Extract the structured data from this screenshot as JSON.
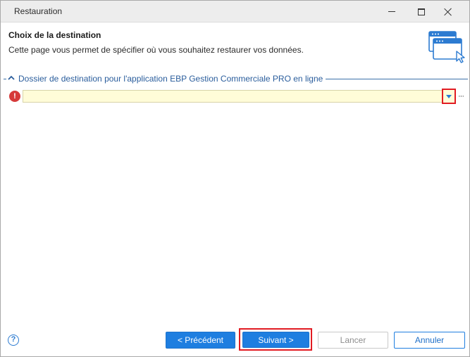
{
  "window": {
    "title": "Restauration"
  },
  "header": {
    "title": "Choix de la destination",
    "subtitle": "Cette page vous permet de spécifier où vous souhaitez restaurer vos données.",
    "icon": "window-cursor-icon"
  },
  "group": {
    "label": "Dossier de destination pour l'application EBP Gestion Commerciale PRO en ligne",
    "icon": "chevron-up-icon"
  },
  "destination": {
    "value": "",
    "placeholder": "",
    "status_icon": "error-icon",
    "status_glyph": "!",
    "browse_glyph": "···"
  },
  "footer": {
    "help_glyph": "?",
    "prev_label": "< Précédent",
    "next_label": "Suivant >",
    "launch_label": "Lancer",
    "cancel_label": "Annuler"
  },
  "colors": {
    "accent": "#1e7ee0",
    "error": "#d63a3a",
    "highlight": "#e11b22",
    "input_bg": "#fffcd8",
    "group_text": "#2a5d9c"
  }
}
